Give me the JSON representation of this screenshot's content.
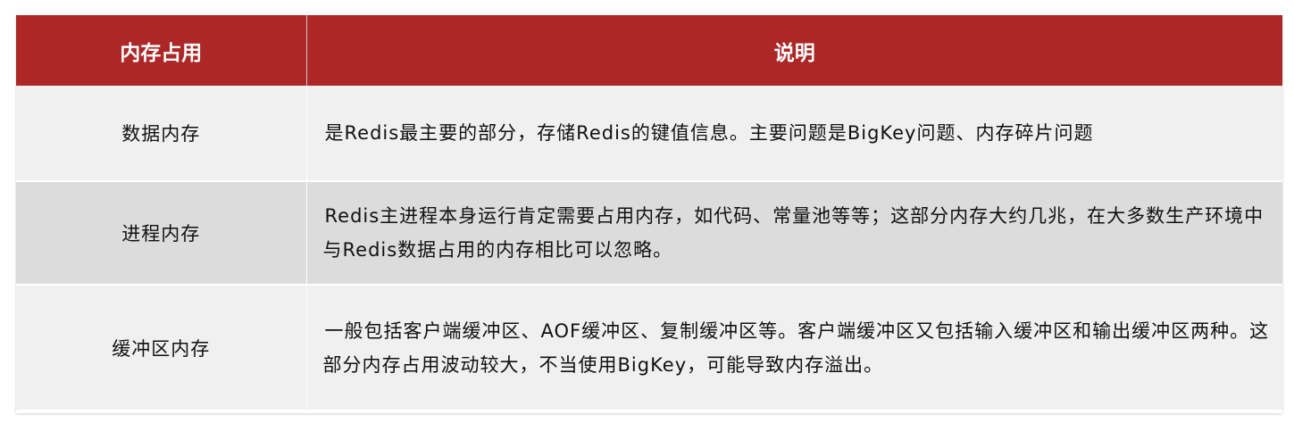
{
  "table": {
    "headers": [
      "内存占用",
      "说明"
    ],
    "rows": [
      {
        "name": "数据内存",
        "description": "是Redis最主要的部分，存储Redis的键值信息。主要问题是BigKey问题、内存碎片问题"
      },
      {
        "name": "进程内存",
        "description": "Redis主进程本身运行肯定需要占用内存，如代码、常量池等等；这部分内存大约几兆，在大多数生产环境中与Redis数据占用的内存相比可以忽略。"
      },
      {
        "name": "缓冲区内存",
        "description": "一般包括客户端缓冲区、AOF缓冲区、复制缓冲区等。客户端缓冲区又包括输入缓冲区和输出缓冲区两种。这部分内存占用波动较大，不当使用BigKey，可能导致内存溢出。"
      }
    ]
  },
  "colors": {
    "header_bg": "#ad2727",
    "header_text": "#ffffff",
    "row_light": "#f0f0f0",
    "row_dark": "#dcdcdc"
  }
}
